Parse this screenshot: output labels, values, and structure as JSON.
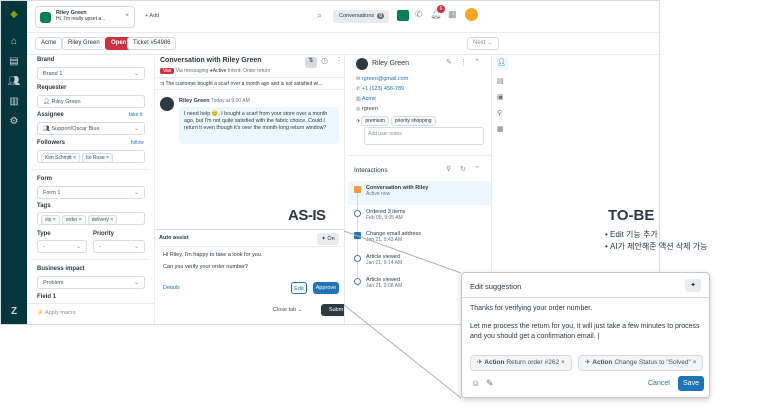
{
  "tab": {
    "name": "Riley Green",
    "preview": "Hi, I'm really upset a...",
    "add": "+ Add"
  },
  "topbar": {
    "conversations": "Conversations",
    "conv_count": "8",
    "notif_count": "6"
  },
  "crumbs": {
    "org": "Acme",
    "user": "Riley Green",
    "status": "Open",
    "ticket": "Ticket #54986",
    "next": "Next"
  },
  "props": {
    "brand_label": "Brand",
    "brand_value": "Brand 1",
    "requester_label": "Requester",
    "requester_value": "Riley Green",
    "assignee_label": "Assignee",
    "take_it": "take it",
    "assignee_value": "Support/Oscar Blue",
    "followers_label": "Followers",
    "follow": "follow",
    "followers": [
      "Kim Schmitt ×",
      "Ito Rose ×"
    ],
    "form_label": "Form",
    "form_value": "Form 1",
    "tags_label": "Tags",
    "tags": [
      "vip ×",
      "order ×",
      "delivery ×"
    ],
    "type_label": "Type",
    "type_value": "-",
    "priority_label": "Priority",
    "priority_value": "-",
    "impact_label": "Business impact",
    "impact_value": "Problem",
    "field1_label": "Field 1",
    "macro": "Apply macro"
  },
  "conversation": {
    "title": "Conversation with Riley Green",
    "badge": "Vax",
    "via": "Via messaging",
    "active": "Active",
    "intent": "Intent: Order return",
    "summary": "The customer bought a scarf over a month ago and is not satisfied wi...",
    "sender": "Riley Green",
    "time": "Today at 9:00 AM",
    "message": "I need help 😊, I bought a scarf from your store over a month ago, but I'm not quite satisfied with the fabric choice. Could I return it even though it's over the month-long return window?",
    "auto_assist": "Auto assist",
    "on": "On",
    "assist_line1": "Hi Riley, I'm happy to take a look for you.",
    "assist_line2": "Can you verify your order number?",
    "details": "Details",
    "edit": "Edit",
    "approve": "Approve",
    "close_tab": "Close tab",
    "submit": "Subm"
  },
  "context": {
    "name": "Riley Green",
    "email": "rgreen@gmail.com",
    "phone": "+1 (123) 456-789",
    "org": "Acme",
    "handle": "rgreen",
    "tags": [
      "premium",
      "priority shopping"
    ],
    "notes_placeholder": "Add user notes",
    "interactions": "Interactions",
    "items": [
      {
        "title": "Conversation with Riley",
        "sub": "Active now"
      },
      {
        "title": "Ordered 3 items",
        "sub": "Feb 09, 9:05 AM"
      },
      {
        "title": "Change email address",
        "sub": "Jan 21, 9:43 AM"
      },
      {
        "title": "Article viewed",
        "sub": "Jan 21, 9:14 AM"
      },
      {
        "title": "Article viewed",
        "sub": "Jan 21, 9:08 AM"
      }
    ]
  },
  "annotations": {
    "as_is": "AS-IS",
    "to_be": "TO-BE",
    "bullet1": "Edit 기능 추가",
    "bullet2": "AI가 제안해준 액션 삭제 가능"
  },
  "edit_panel": {
    "title": "Edit suggestion",
    "line1": "Thanks for verifying your order number.",
    "line2": "Let me process the return for you, it will just take a few minutes to process and you should get a confirmation email. |",
    "chip1_action": "Action",
    "chip1_text": "Return order #262",
    "chip2_action": "Action",
    "chip2_text": "Change Status to \"Solved\"",
    "cancel": "Cancel",
    "save": "Save"
  },
  "colors": {
    "nav": "#03363d",
    "open": "#cc3340",
    "accent": "#1f73b7",
    "active_green": "#038153"
  }
}
